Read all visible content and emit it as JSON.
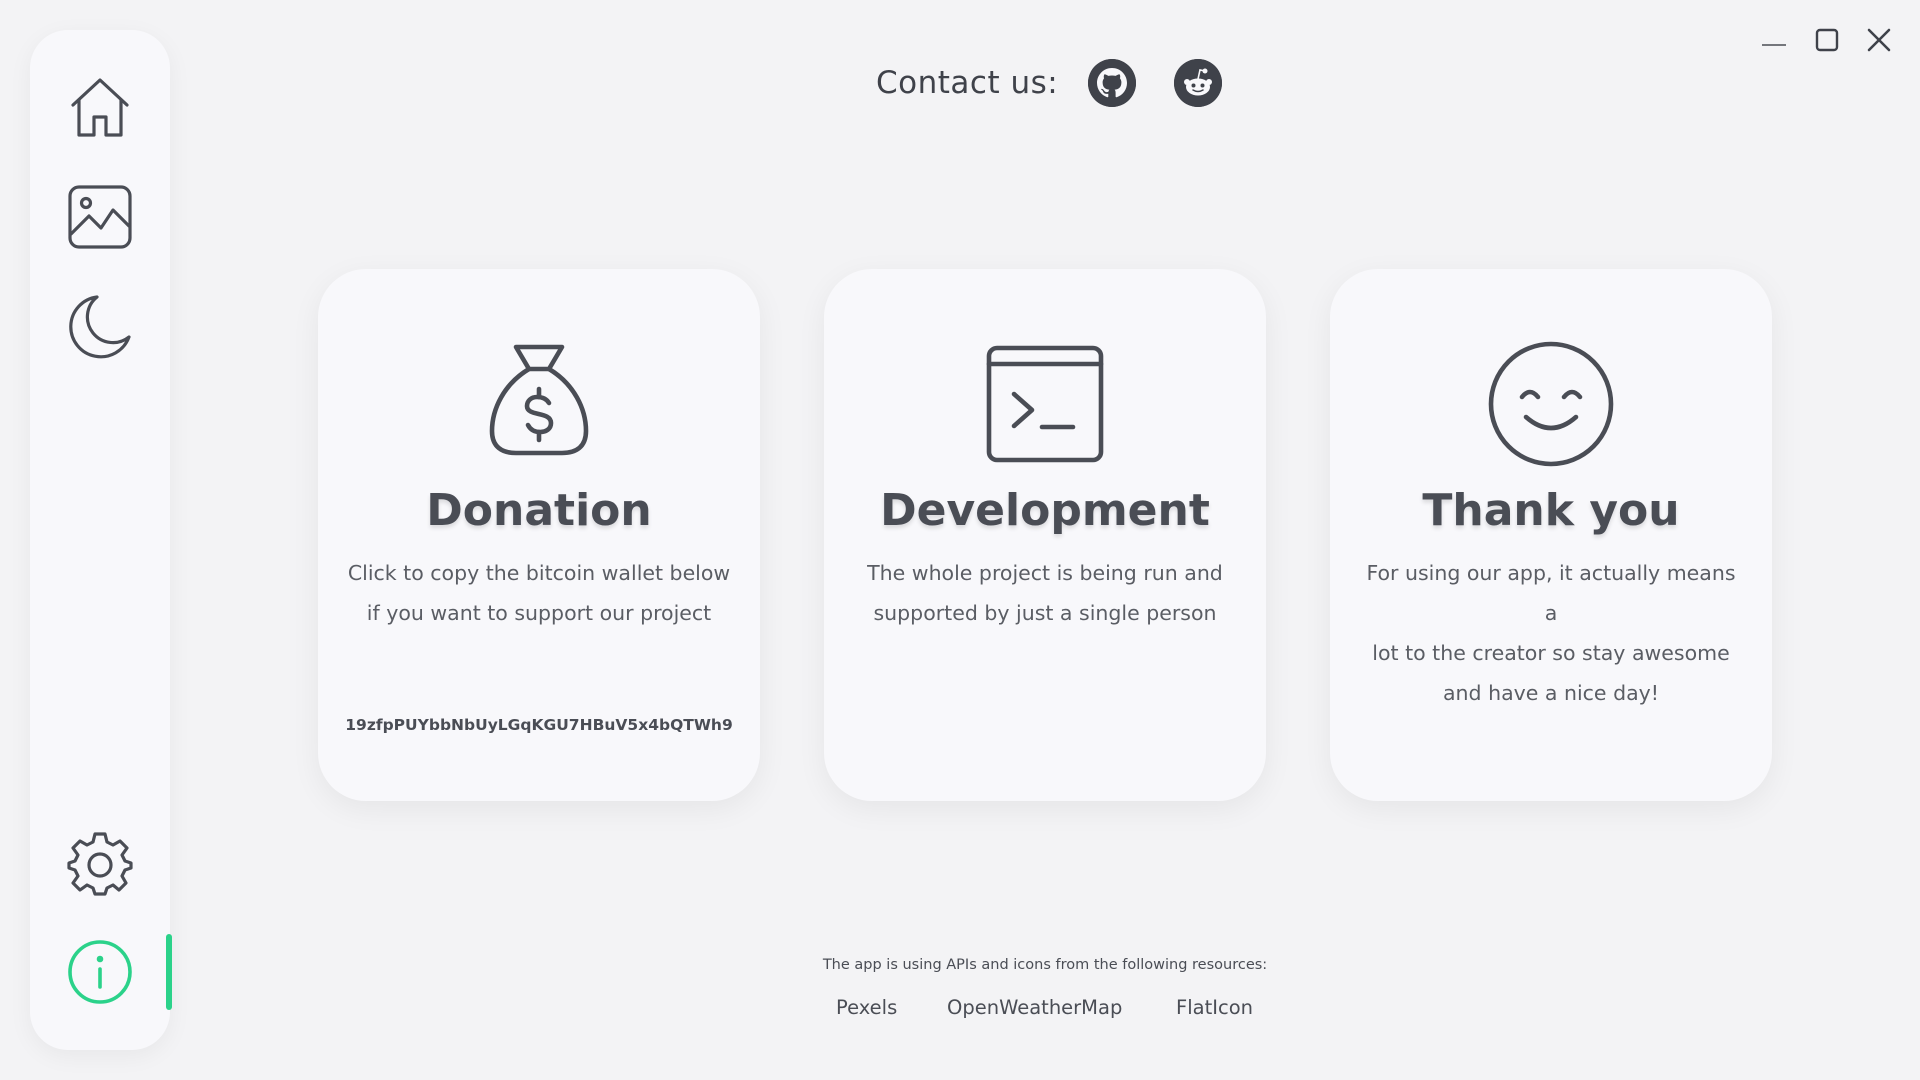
{
  "window": {
    "controls": [
      {
        "name": "minimize",
        "icon": "minimize-icon"
      },
      {
        "name": "maximize",
        "icon": "maximize-icon"
      },
      {
        "name": "close",
        "icon": "close-icon"
      }
    ]
  },
  "sidebar": {
    "items": [
      {
        "id": "home",
        "icon": "home-icon"
      },
      {
        "id": "wallpapers",
        "icon": "image-icon"
      },
      {
        "id": "dark-mode",
        "icon": "moon-icon"
      },
      {
        "id": "settings",
        "icon": "gear-icon"
      },
      {
        "id": "info",
        "icon": "info-icon",
        "active": true
      }
    ],
    "active_color": "#2bd28a"
  },
  "contact": {
    "label": "Contact us:",
    "links": [
      {
        "icon": "github-icon"
      },
      {
        "icon": "reddit-icon"
      }
    ]
  },
  "cards": [
    {
      "icon": "money-bag-icon",
      "title": "Donation",
      "text_line1": "Click to copy the bitcoin wallet below",
      "text_line2": "if you want to support our project",
      "wallet": "19zfpPUYbbNbUyLGqKGU7HBuV5x4bQTWh9"
    },
    {
      "icon": "terminal-icon",
      "title": "Development",
      "text_line1": "The whole project is being run and",
      "text_line2": "supported by just a single person"
    },
    {
      "icon": "smile-icon",
      "title": "Thank you",
      "text_line1": "For using our app, it actually means a",
      "text_line2": "lot to the creator so stay awesome",
      "text_line3": "and have a nice day!"
    }
  ],
  "footer": {
    "note": "The app is using APIs and icons from the following resources:",
    "links": [
      "Pexels",
      "OpenWeatherMap",
      "FlatIcon"
    ]
  },
  "colors": {
    "background": "#f3f3f5",
    "card": "#f8f8fb",
    "icon": "#4a4d55",
    "accent": "#2bd28a"
  }
}
